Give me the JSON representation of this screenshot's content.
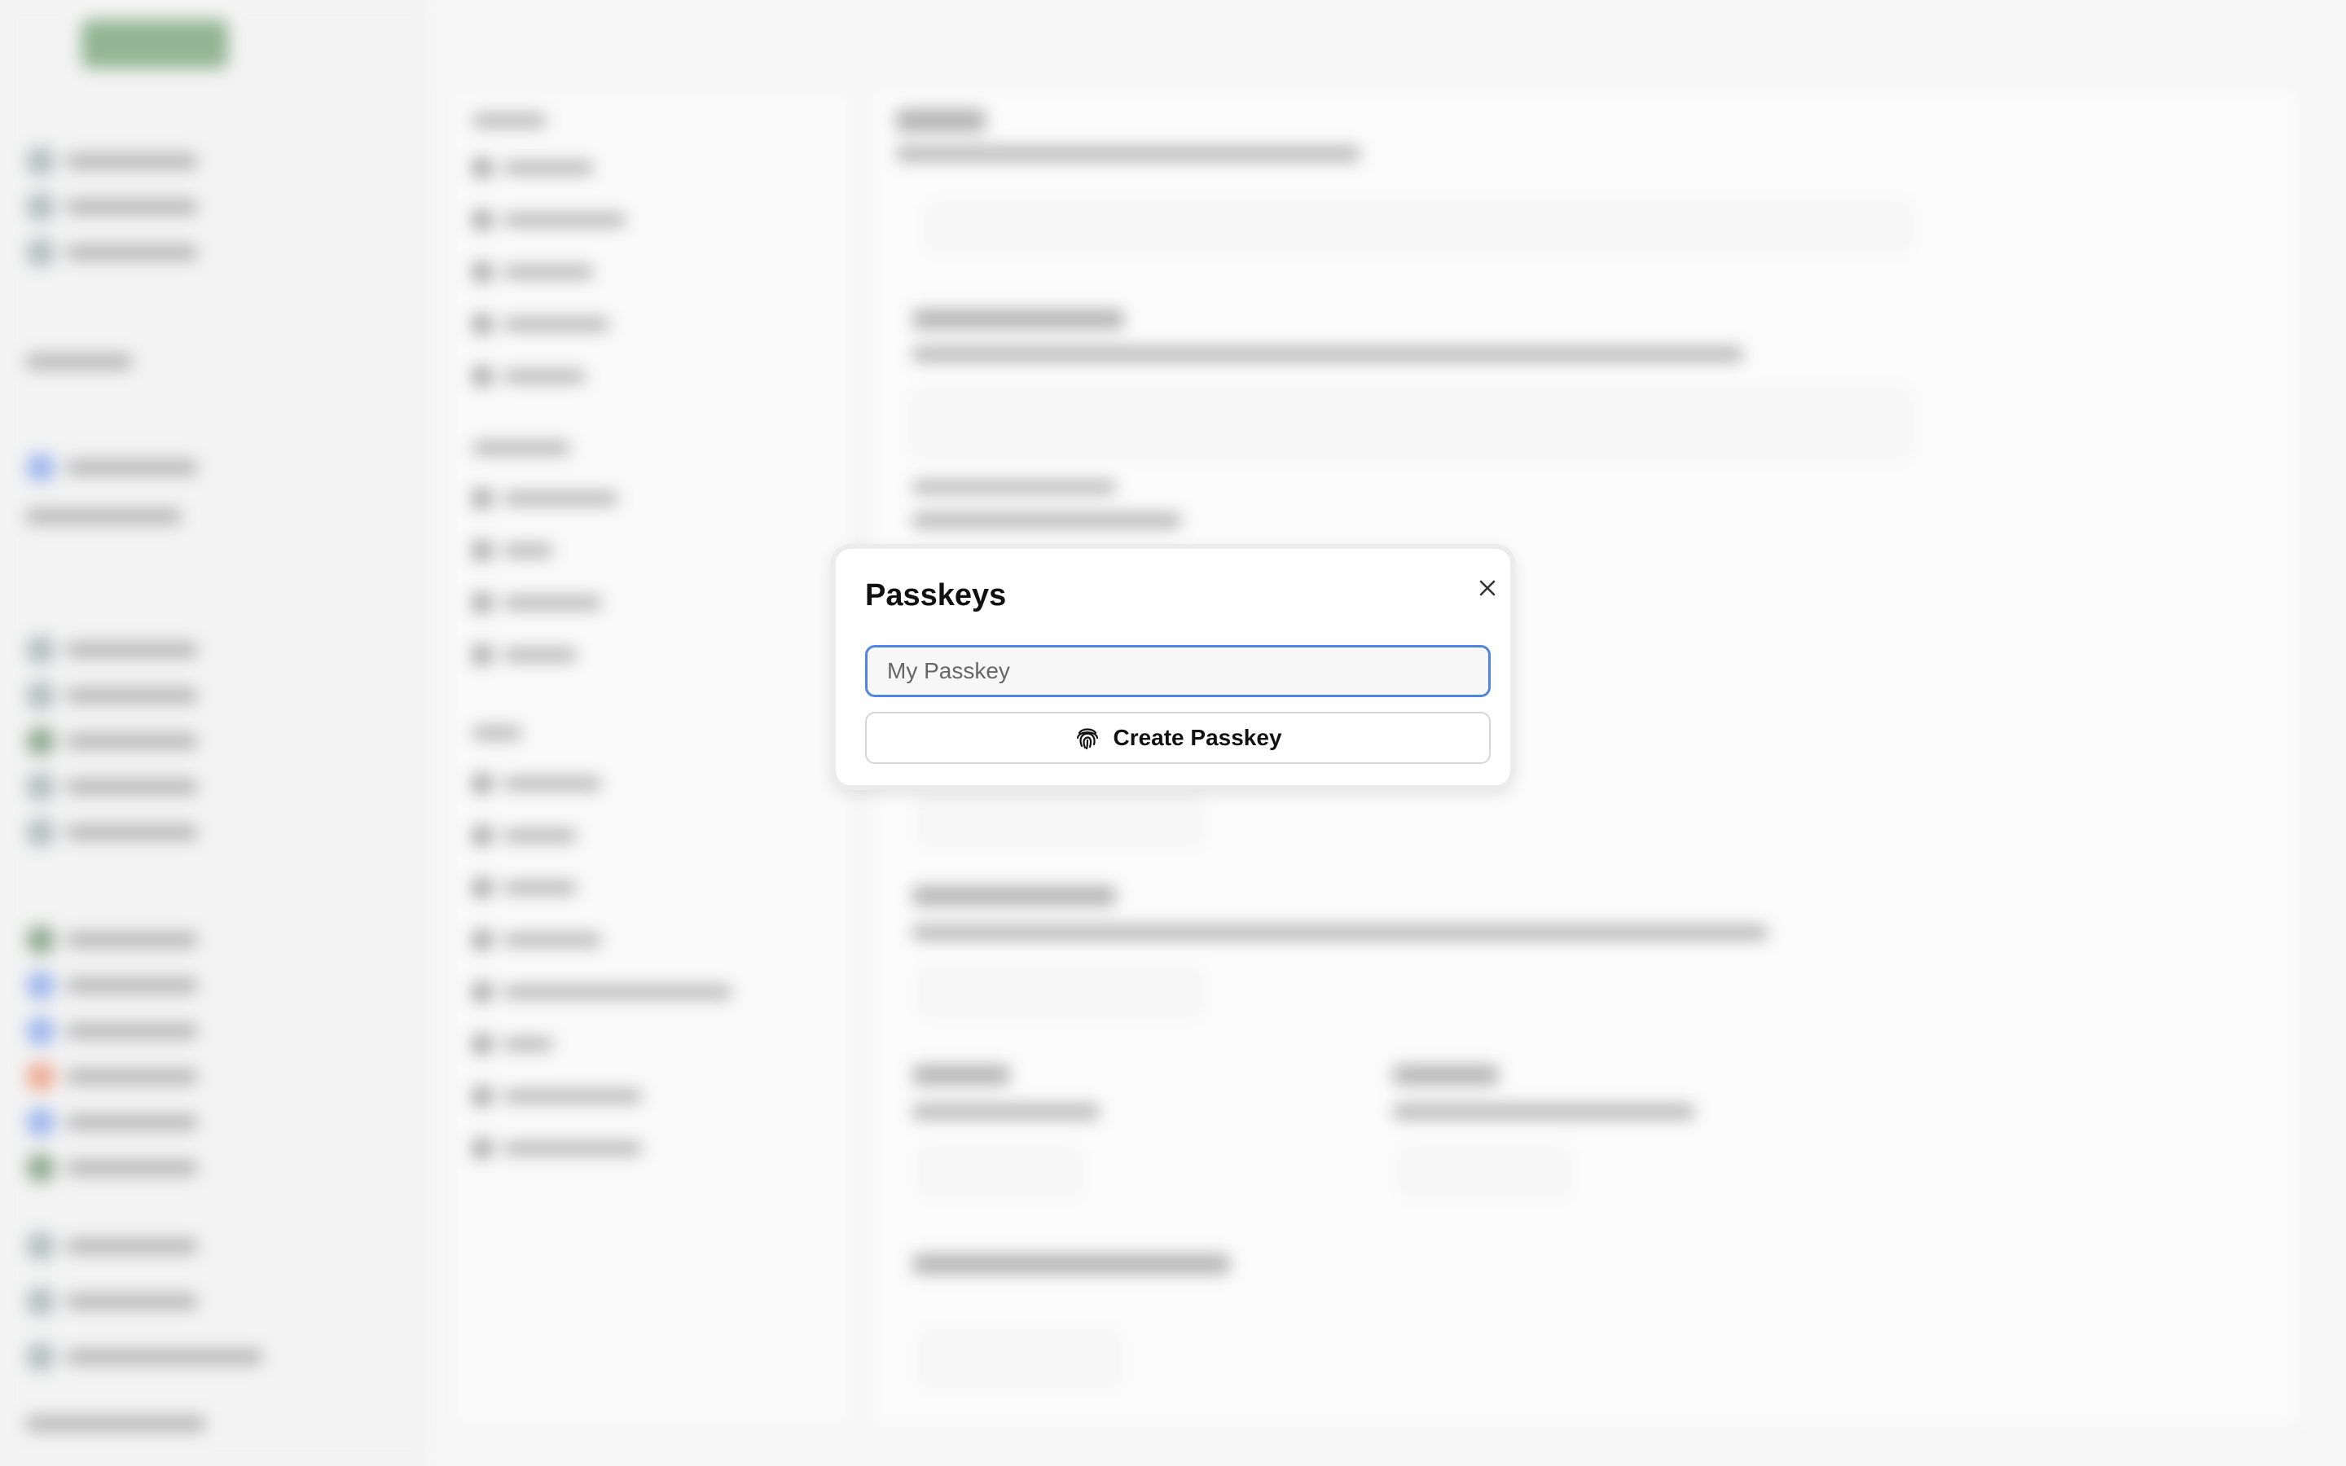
{
  "modal": {
    "title": "Passkeys",
    "close_icon": "close-icon",
    "input": {
      "value": "",
      "placeholder": "My Passkey"
    },
    "create_button": {
      "label": "Create Passkey",
      "icon": "fingerprint-icon"
    }
  },
  "colors": {
    "input_focus_border": "#4f86e0",
    "modal_background": "#ffffff",
    "backdrop": "#f2f2f2"
  }
}
